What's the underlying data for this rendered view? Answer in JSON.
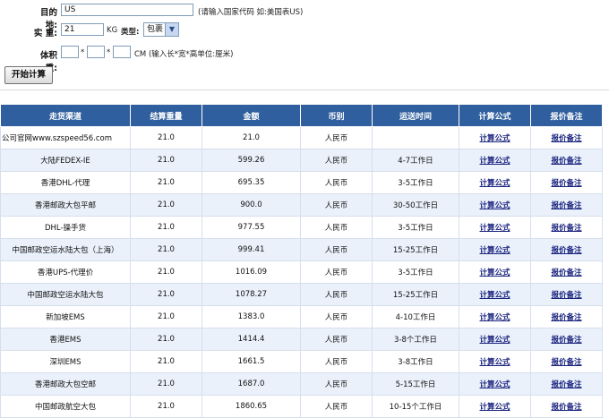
{
  "form": {
    "destination_label": "目的地:",
    "destination_value": "US",
    "destination_hint": "(请输入国家代码 如:美国表US)",
    "weight_label": "实  重:",
    "weight_value": "21",
    "weight_unit": "KG",
    "type_label": "类型:",
    "type_value": "包裹",
    "volume_label": "体积重:",
    "volume_sep1": "*",
    "volume_sep2": "*",
    "volume_hint": "CM (输入长*宽*高单位:厘米)",
    "submit_label": "开始计算"
  },
  "table": {
    "headers": [
      "走货渠道",
      "结算重量",
      "金额",
      "币别",
      "运送时间",
      "计算公式",
      "报价备注"
    ],
    "rows": [
      [
        "公司官网www.szspeed56.com",
        "21.0",
        "21.0",
        "人民币",
        "",
        "计算公式",
        "报价备注"
      ],
      [
        "大陆FEDEX-IE",
        "21.0",
        "599.26",
        "人民币",
        "4-7工作日",
        "计算公式",
        "报价备注"
      ],
      [
        "香港DHL-代理",
        "21.0",
        "695.35",
        "人民币",
        "3-5工作日",
        "计算公式",
        "报价备注"
      ],
      [
        "香港邮政大包平邮",
        "21.0",
        "900.0",
        "人民币",
        "30-50工作日",
        "计算公式",
        "报价备注"
      ],
      [
        "DHL-操手货",
        "21.0",
        "977.55",
        "人民币",
        "3-5工作日",
        "计算公式",
        "报价备注"
      ],
      [
        "中国邮政空运水陆大包（上海）",
        "21.0",
        "999.41",
        "人民币",
        "15-25工作日",
        "计算公式",
        "报价备注"
      ],
      [
        "香港UPS-代理价",
        "21.0",
        "1016.09",
        "人民币",
        "3-5工作日",
        "计算公式",
        "报价备注"
      ],
      [
        "中国邮政空运水陆大包",
        "21.0",
        "1078.27",
        "人民币",
        "15-25工作日",
        "计算公式",
        "报价备注"
      ],
      [
        "新加坡EMS",
        "21.0",
        "1383.0",
        "人民币",
        "4-10工作日",
        "计算公式",
        "报价备注"
      ],
      [
        "香港EMS",
        "21.0",
        "1414.4",
        "人民币",
        "3-8个工作日",
        "计算公式",
        "报价备注"
      ],
      [
        "深圳EMS",
        "21.0",
        "1661.5",
        "人民币",
        "3-8工作日",
        "计算公式",
        "报价备注"
      ],
      [
        "香港邮政大包空邮",
        "21.0",
        "1687.0",
        "人民币",
        "5-15工作日",
        "计算公式",
        "报价备注"
      ],
      [
        "中国邮政航空大包",
        "21.0",
        "1860.65",
        "人民币",
        "10-15个工作日",
        "计算公式",
        "报价备注"
      ]
    ]
  },
  "colors": {
    "header_bg": "#2f5f9e",
    "alt_row_bg": "#eaf1fb",
    "link": "#1a237e"
  }
}
